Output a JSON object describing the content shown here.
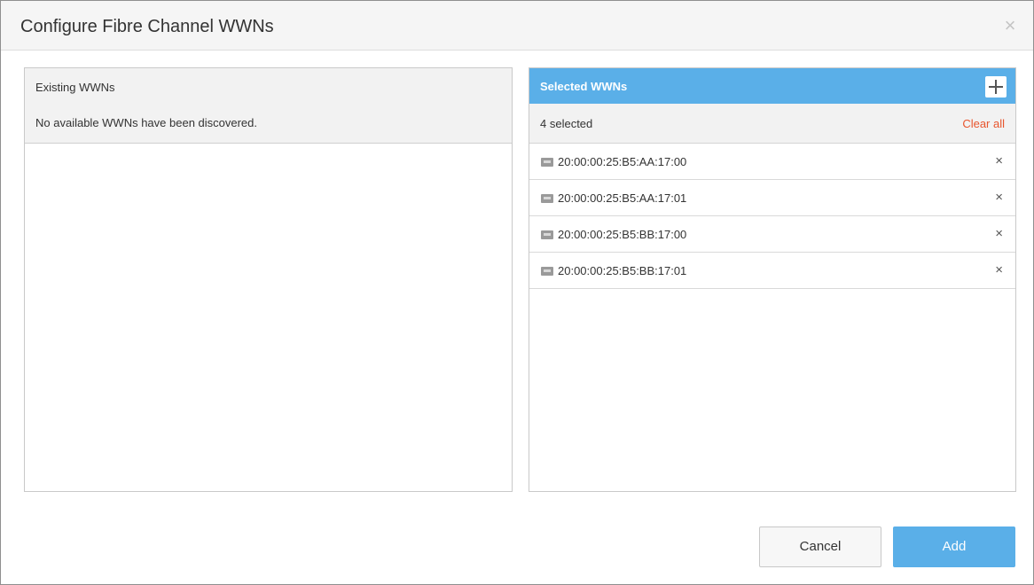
{
  "dialog": {
    "title": "Configure Fibre Channel WWNs",
    "close_label": "×"
  },
  "existing": {
    "title": "Existing WWNs",
    "message": "No available WWNs have been discovered."
  },
  "selected": {
    "title": "Selected WWNs",
    "count_text": "4 selected",
    "clear_all_label": "Clear all",
    "items": [
      {
        "wwn": "20:00:00:25:B5:AA:17:00",
        "remove_label": "×",
        "icon": "fibre-port-icon"
      },
      {
        "wwn": "20:00:00:25:B5:AA:17:01",
        "remove_label": "×",
        "icon": "fibre-port-icon"
      },
      {
        "wwn": "20:00:00:25:B5:BB:17:00",
        "remove_label": "×",
        "icon": "fibre-port-icon"
      },
      {
        "wwn": "20:00:00:25:B5:BB:17:01",
        "remove_label": "×",
        "icon": "fibre-port-icon"
      }
    ]
  },
  "footer": {
    "cancel_label": "Cancel",
    "add_label": "Add"
  },
  "colors": {
    "accent": "#5aafe8",
    "clear_all": "#e8552d"
  }
}
